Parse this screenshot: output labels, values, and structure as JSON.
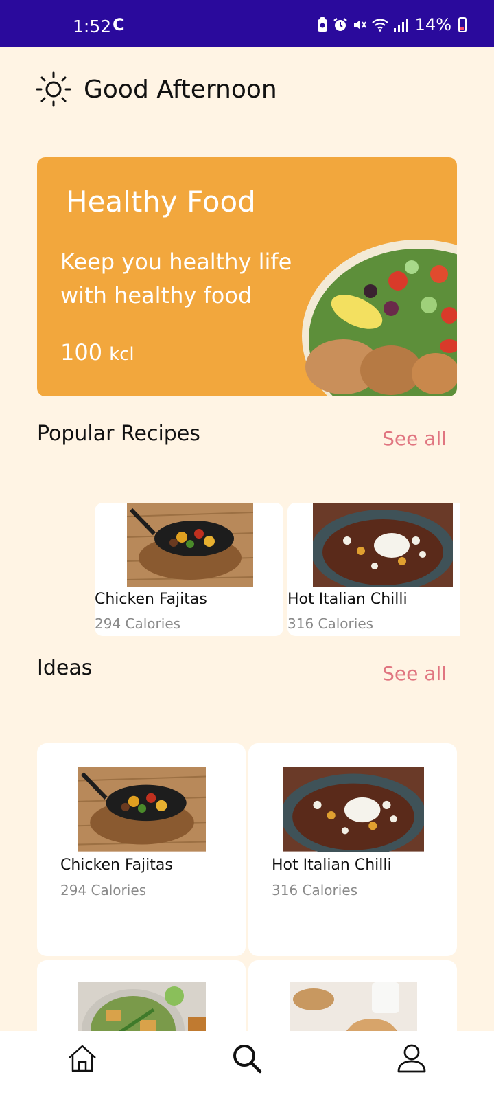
{
  "status_bar": {
    "time": "1:52",
    "sync_glyph": "C",
    "battery_percent": "14%",
    "icons": [
      "battery-saver-icon",
      "alarm-icon",
      "mute-icon",
      "wifi-icon",
      "signal-icon",
      "battery-icon"
    ]
  },
  "greeting": {
    "icon": "sun-icon",
    "text": "Good Afternoon"
  },
  "hero": {
    "title": "Healthy Food",
    "subtitle": "Keep you healthy life with healthy food",
    "kcal_value": "100",
    "kcal_unit": "kcl",
    "background_color": "#f2a73d"
  },
  "popular": {
    "title": "Popular Recipes",
    "see_all": "See all",
    "items": [
      {
        "name": "Chicken Fajitas",
        "calories": "294 Calories"
      },
      {
        "name": "Hot Italian Chilli",
        "calories": "316 Calories"
      }
    ]
  },
  "ideas": {
    "title": "Ideas",
    "see_all": "See all",
    "items": [
      {
        "name": "Chicken Fajitas",
        "calories": "294 Calories"
      },
      {
        "name": "Hot Italian Chilli",
        "calories": "316 Calories"
      },
      {
        "name": "",
        "calories": ""
      },
      {
        "name": "",
        "calories": ""
      }
    ]
  },
  "nav": {
    "items": [
      "home-icon",
      "search-icon",
      "profile-icon"
    ]
  },
  "colors": {
    "background": "#fff4e4",
    "status_bar": "#2a0a9c",
    "accent": "#e07580",
    "card": "#ffffff"
  }
}
